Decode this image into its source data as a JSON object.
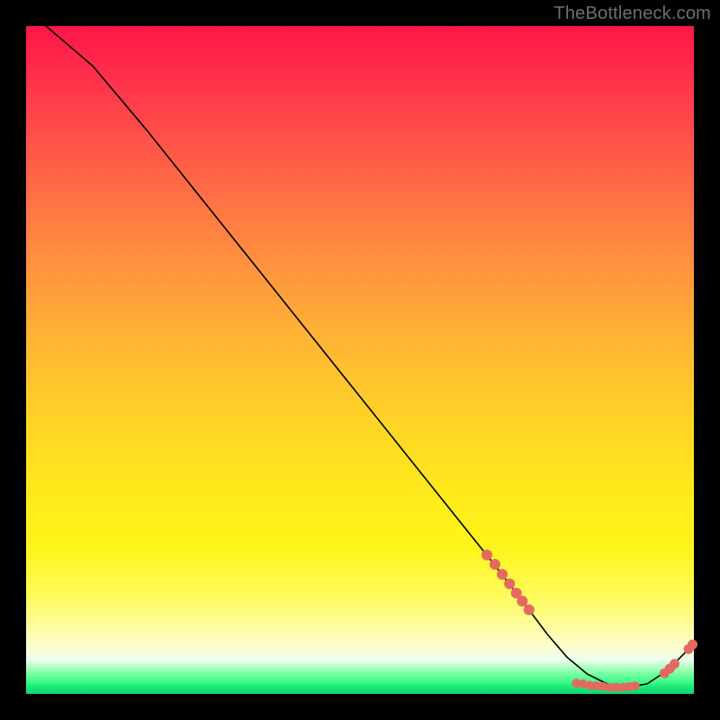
{
  "watermark": "TheBottleneck.com",
  "chart_data": {
    "type": "line",
    "title": "",
    "xlabel": "",
    "ylabel": "",
    "xlim": [
      0,
      100
    ],
    "ylim": [
      0,
      100
    ],
    "grid": false,
    "series": [
      {
        "name": "curve",
        "x": [
          3,
          10,
          18,
          26,
          34,
          42,
          50,
          58,
          64,
          70,
          75,
          78,
          81,
          84,
          87,
          90,
          93,
          96,
          100
        ],
        "y": [
          100,
          94,
          84.5,
          74.5,
          64.5,
          54.5,
          44.5,
          34.5,
          27,
          19.5,
          13,
          9,
          5.5,
          3,
          1.5,
          1,
          1.5,
          3.5,
          7.5
        ],
        "color": "#000000",
        "linewidth": 1.6
      }
    ],
    "scatter_overlays": [
      {
        "name": "dots-left-cluster",
        "color": "#e46a61",
        "radius": 6,
        "points": [
          {
            "x": 69.0,
            "y": 20.8
          },
          {
            "x": 70.2,
            "y": 19.4
          },
          {
            "x": 71.3,
            "y": 17.9
          },
          {
            "x": 72.4,
            "y": 16.5
          },
          {
            "x": 73.4,
            "y": 15.1
          },
          {
            "x": 74.3,
            "y": 13.9
          },
          {
            "x": 75.3,
            "y": 12.6
          }
        ]
      },
      {
        "name": "dots-bottom-flat",
        "color": "#e46a61",
        "radius": 5,
        "points": [
          {
            "x": 82.4,
            "y": 1.6
          },
          {
            "x": 83.4,
            "y": 1.5
          },
          {
            "x": 84.4,
            "y": 1.3
          },
          {
            "x": 85.4,
            "y": 1.2
          },
          {
            "x": 86.4,
            "y": 1.1
          },
          {
            "x": 87.4,
            "y": 1.0
          },
          {
            "x": 88.4,
            "y": 1.0
          },
          {
            "x": 89.4,
            "y": 1.0
          },
          {
            "x": 90.3,
            "y": 1.1
          },
          {
            "x": 91.2,
            "y": 1.2
          }
        ]
      },
      {
        "name": "dots-right-cluster",
        "color": "#e46a61",
        "radius": 5.5,
        "points": [
          {
            "x": 95.6,
            "y": 3.1
          },
          {
            "x": 96.4,
            "y": 3.8
          },
          {
            "x": 97.1,
            "y": 4.5
          }
        ]
      },
      {
        "name": "dots-top-pair",
        "color": "#e46a61",
        "radius": 5.5,
        "points": [
          {
            "x": 99.2,
            "y": 6.7
          },
          {
            "x": 99.8,
            "y": 7.4
          }
        ]
      }
    ]
  }
}
